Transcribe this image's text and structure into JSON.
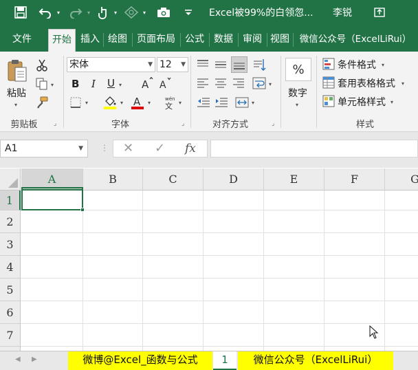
{
  "title_bar": {
    "doc_title": "Excel被99%的白领忽...",
    "user_name": "李锐"
  },
  "tabs": [
    {
      "label": "文件"
    },
    {
      "label": "开始"
    },
    {
      "label": "插入"
    },
    {
      "label": "绘图"
    },
    {
      "label": "页面布局"
    },
    {
      "label": "公式"
    },
    {
      "label": "数据"
    },
    {
      "label": "审阅"
    },
    {
      "label": "视图"
    },
    {
      "label": "微信公众号（ExcelLiRui）"
    }
  ],
  "ribbon": {
    "clipboard": {
      "paste_label": "粘贴",
      "group_label": "剪贴板"
    },
    "font": {
      "font_name": "宋体",
      "font_size": "12",
      "bold": "B",
      "italic": "I",
      "underline": "U",
      "font_color_glyph": "A",
      "highlight_color": "#ffff00",
      "font_color": "#e00000",
      "group_label": "字体"
    },
    "alignment": {
      "group_label": "对齐方式"
    },
    "number": {
      "percent_symbol": "%",
      "label": "数字"
    },
    "styles": {
      "conditional_format": "条件格式",
      "table_format": "套用表格格式",
      "cell_styles": "单元格样式",
      "group_label": "样式"
    }
  },
  "formula_bar": {
    "name_box": "A1",
    "cancel_glyph": "✕",
    "enter_glyph": "✓",
    "fx_glyph": "fx",
    "formula": ""
  },
  "grid": {
    "columns": [
      "A",
      "B",
      "C",
      "D",
      "E",
      "F",
      "G"
    ],
    "rows": [
      "1",
      "2",
      "3",
      "4",
      "5",
      "6",
      "7"
    ],
    "active_cell": "A1"
  },
  "sheets": [
    {
      "label": "微博@Excel_函数与公式",
      "highlighted": true
    },
    {
      "label": "1",
      "active": true
    },
    {
      "label": "微信公众号（ExcelLiRui）",
      "highlighted": true
    }
  ],
  "colors": {
    "accent": "#217346",
    "highlight": "#ffff00"
  }
}
